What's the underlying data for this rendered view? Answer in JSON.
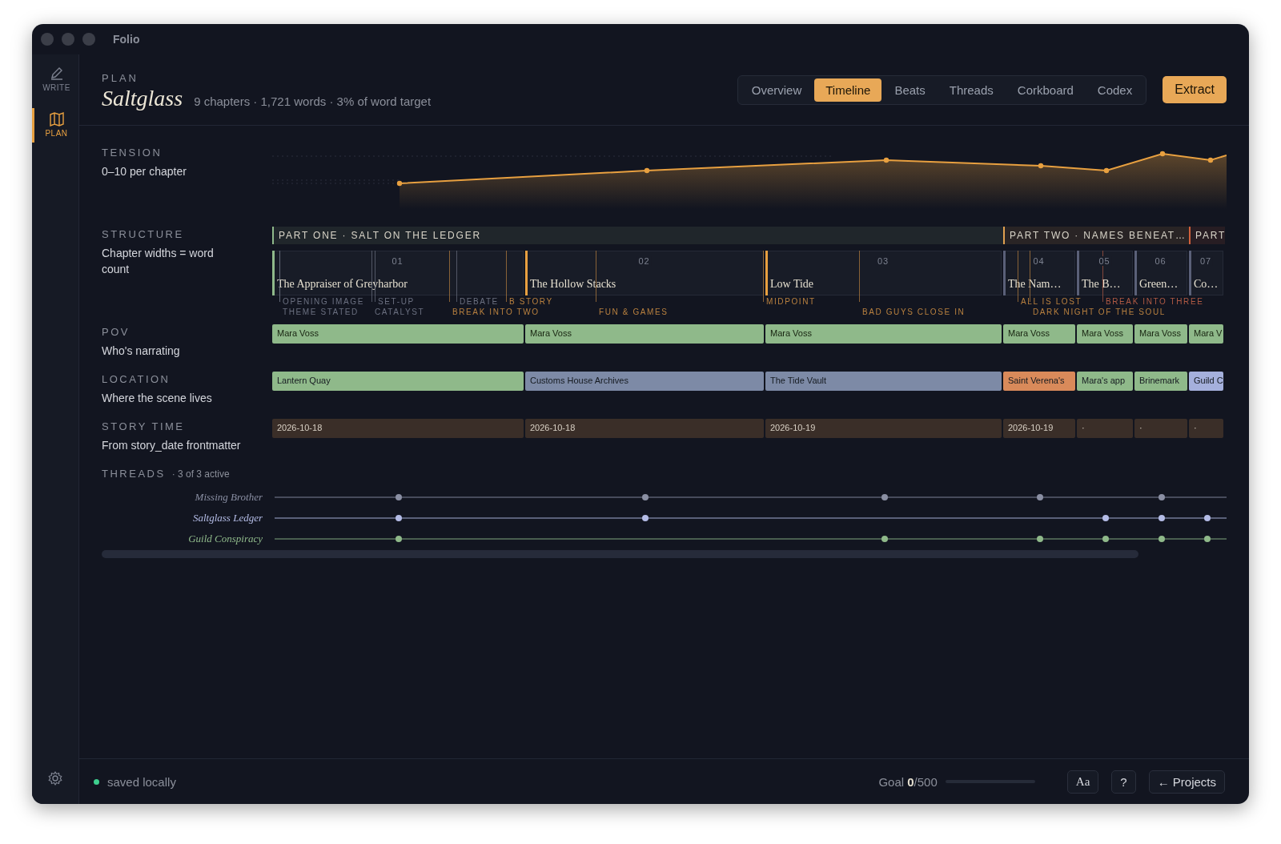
{
  "window": {
    "title": "Folio"
  },
  "sidebar": {
    "items": [
      {
        "label": "WRITE",
        "kind": "pencil",
        "selected": false
      },
      {
        "label": "PLAN",
        "kind": "map",
        "selected": true
      }
    ]
  },
  "header": {
    "section": "PLAN",
    "title": "Saltglass",
    "summary": "9 chapters · 1,721 words · 3% of word target"
  },
  "tabs": [
    {
      "label": "Overview",
      "selected": false
    },
    {
      "label": "Timeline",
      "selected": true
    },
    {
      "label": "Beats",
      "selected": false
    },
    {
      "label": "Threads",
      "selected": false
    },
    {
      "label": "Corkboard",
      "selected": false
    },
    {
      "label": "Codex",
      "selected": false
    }
  ],
  "extract_button": "Extract",
  "lanes": {
    "tension": {
      "title": "TENSION",
      "subtitle": "0–10 per chapter"
    },
    "structure": {
      "title": "STRUCTURE",
      "subtitle": "Chapter widths = word count"
    },
    "pov": {
      "title": "POV",
      "subtitle": "Who's narrating"
    },
    "location": {
      "title": "LOCATION",
      "subtitle": "Where the scene lives"
    },
    "story_time": {
      "title": "STORY TIME",
      "subtitle": "From story_date frontmatter"
    }
  },
  "parts": [
    {
      "label": "PART ONE · SALT ON THE LEDGER",
      "color": "#8fb98a",
      "chapters": [
        {
          "number": "01",
          "title": "The Appraiser of Greyharbor",
          "color": "#8fb98a",
          "pov": "Mara Voss",
          "location": {
            "name": "Lantern Quay",
            "color": "#8fb98a"
          },
          "story_time": "2026-10-18"
        },
        {
          "number": "02",
          "title": "The Hollow Stacks",
          "color": "#e8a040",
          "pov": "Mara Voss",
          "location": {
            "name": "Customs House Archives",
            "color": "#7d8aa6"
          },
          "story_time": "2026-10-18"
        },
        {
          "number": "03",
          "title": "Low Tide",
          "color": "#e8a040",
          "pov": "Mara Voss",
          "location": {
            "name": "The Tide Vault",
            "color": "#7d8aa6"
          },
          "story_time": "2026-10-19"
        }
      ]
    },
    {
      "label": "PART TWO · NAMES BENEAT…",
      "color": "#e0a050",
      "chapters": [
        {
          "number": "04",
          "title": "The Nam…",
          "color": "#5a6078",
          "pov": "Mara Voss",
          "location": {
            "name": "Saint Verena's",
            "color": "#d98a5a"
          },
          "story_time": "2026-10-19"
        },
        {
          "number": "05",
          "title": "The B…",
          "color": "#5a6078",
          "pov": "Mara Voss",
          "location": {
            "name": "Mara's app",
            "color": "#8fb98a"
          },
          "story_time": "·"
        },
        {
          "number": "06",
          "title": "Green…",
          "color": "#5a6078",
          "pov": "Mara Voss",
          "location": {
            "name": "Brinemark",
            "color": "#8fb98a"
          },
          "story_time": "·"
        }
      ]
    },
    {
      "label": "PART",
      "color": "#d0603c",
      "chapters": [
        {
          "number": "07",
          "title": "Co…",
          "color": "#5a6078",
          "pov": "Mara V",
          "location": {
            "name": "Guild C",
            "color": "#a5b0dc"
          },
          "story_time": "·"
        }
      ]
    }
  ],
  "beats": [
    {
      "label": "OPENING IMAGE",
      "color": "#6b7080"
    },
    {
      "label": "SET-UP",
      "color": "#6b7080"
    },
    {
      "label": "DEBATE",
      "color": "#6b7080"
    },
    {
      "label": "B STORY",
      "color": "#b8803f"
    },
    {
      "label": "MIDPOINT",
      "color": "#b8803f"
    },
    {
      "label": "ALL IS LOST",
      "color": "#b8803f"
    },
    {
      "label": "BREAK INTO THREE",
      "color": "#b05a44"
    },
    {
      "label": "THEME STATED",
      "color": "#6b7080"
    },
    {
      "label": "CATALYST",
      "color": "#6b7080"
    },
    {
      "label": "BREAK INTO TWO",
      "color": "#b8803f"
    },
    {
      "label": "FUN & GAMES",
      "color": "#b8803f"
    },
    {
      "label": "BAD GUYS CLOSE IN",
      "color": "#b8803f"
    },
    {
      "label": "DARK NIGHT OF THE SOUL",
      "color": "#b8803f"
    }
  ],
  "threads": {
    "title": "THREADS",
    "count": "· 3 of 3 active",
    "items": [
      {
        "name": "Missing Brother",
        "color": "#8a8fa3",
        "appearances": [
          true,
          true,
          true,
          true,
          false,
          true,
          false
        ]
      },
      {
        "name": "Saltglass Ledger",
        "color": "#b4bce6",
        "appearances": [
          true,
          true,
          false,
          false,
          true,
          true,
          true
        ]
      },
      {
        "name": "Guild Conspiracy",
        "color": "#8fb98a",
        "appearances": [
          true,
          false,
          true,
          true,
          true,
          true,
          true
        ]
      }
    ]
  },
  "status_bar": {
    "status": "saved locally",
    "saved": true,
    "goal": {
      "text": "Goal **0**/500",
      "level": 0
    },
    "buttons": [
      "Aa",
      "?",
      "← Projects"
    ]
  }
}
